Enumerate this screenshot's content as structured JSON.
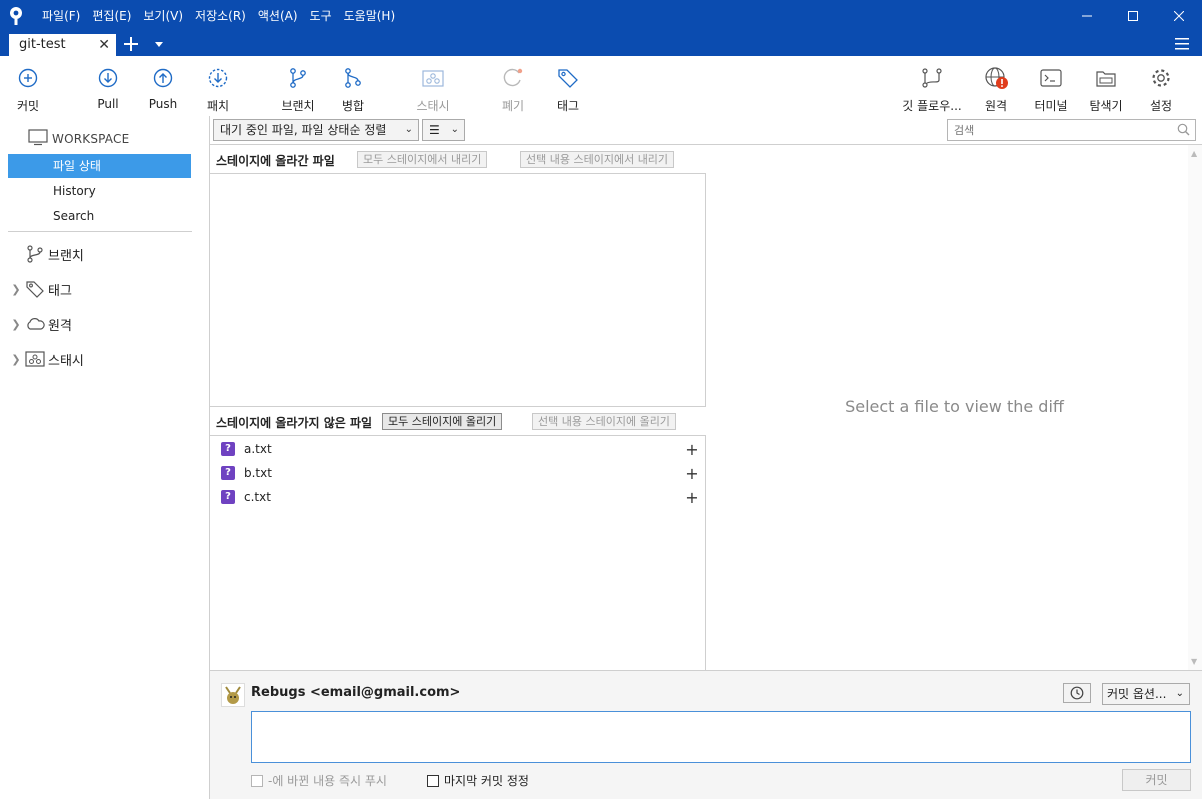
{
  "menu": [
    "파일(F)",
    "편집(E)",
    "보기(V)",
    "저장소(R)",
    "액션(A)",
    "도구",
    "도움말(H)"
  ],
  "tab": {
    "title": "git-test"
  },
  "toolbar": {
    "commit": "커밋",
    "pull": "Pull",
    "push": "Push",
    "fetch": "패치",
    "branch": "브랜치",
    "merge": "병합",
    "stash": "스태시",
    "discard": "폐기",
    "tag": "태그",
    "gitflow": "깃 플로우...",
    "remote": "원격",
    "terminal": "터미널",
    "explorer": "탐색기",
    "settings": "설정"
  },
  "sidebar": {
    "workspace": "WORKSPACE",
    "items": [
      "파일 상태",
      "History",
      "Search"
    ],
    "groups": [
      {
        "label": "브랜치",
        "icon": "branch-icon"
      },
      {
        "label": "태그",
        "icon": "tag-icon"
      },
      {
        "label": "원격",
        "icon": "cloud-icon"
      },
      {
        "label": "스태시",
        "icon": "stash-icon"
      }
    ]
  },
  "filter": {
    "sort_label": "대기 중인 파일, 파일 상태순 정렬",
    "view_label": "☰",
    "search_placeholder": "검색"
  },
  "staged": {
    "title": "스테이지에 올라간 파일",
    "unstage_all": "모두 스테이지에서 내리기",
    "unstage_selected": "선택 내용 스테이지에서 내리기"
  },
  "unstaged": {
    "title": "스테이지에 올라가지 않은 파일",
    "stage_all": "모두 스테이지에 올리기",
    "stage_selected": "선택 내용 스테이지에 올리기",
    "files": [
      {
        "name": "a.txt",
        "status": "?"
      },
      {
        "name": "b.txt",
        "status": "?"
      },
      {
        "name": "c.txt",
        "status": "?"
      }
    ]
  },
  "diff": {
    "placeholder": "Select a file to view the diff"
  },
  "commit": {
    "author": "Rebugs <email@gmail.com>",
    "options": "커밋 옵션...",
    "message": "",
    "push_immediately": "-에 바뀐 내용 즉시 푸시",
    "amend": "마지막 커밋 정정",
    "button": "커밋"
  },
  "colors": {
    "titlebar": "#0b4cb0",
    "selection": "#3c9ae8",
    "untracked": "#6f42c1",
    "alert": "#e03c1c"
  }
}
